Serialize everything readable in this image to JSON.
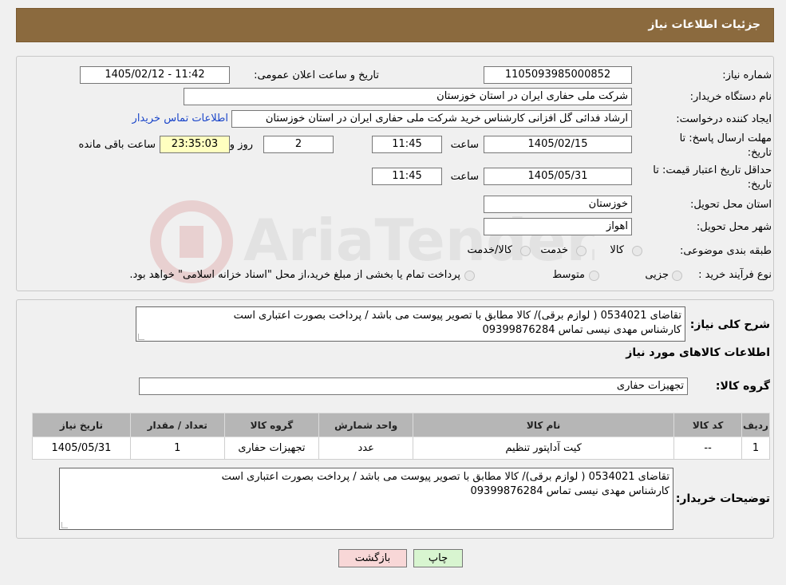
{
  "header": {
    "title": "جزئیات اطلاعات نیاز"
  },
  "form": {
    "need_number_label": "شماره نیاز:",
    "need_number": "1105093985000852",
    "announce_label": "تاریخ و ساعت اعلان عمومی:",
    "announce_value": "1405/02/12 - 11:42",
    "buyer_label": "نام دستگاه خریدار:",
    "buyer_value": "شرکت ملی حفاری ایران در استان خوزستان",
    "creator_label": "ایجاد کننده درخواست:",
    "creator_value": "ارشاد فدائی گل افزانی کارشناس خرید شرکت ملی حفاری ایران در استان خوزستان",
    "contact_link": "اطلاعات تماس خریدار",
    "deadline_label_1": "مهلت ارسال پاسخ: تا",
    "deadline_label_2": "تاریخ:",
    "deadline_date": "1405/02/15",
    "time_label": "ساعت",
    "deadline_time": "11:45",
    "days_value": "2",
    "days_label": "روز و",
    "remaining_value": "23:35:03",
    "remaining_label": "ساعت باقی مانده",
    "validity_label_1": "حداقل تاریخ اعتبار قیمت: تا",
    "validity_label_2": "تاریخ:",
    "validity_date": "1405/05/31",
    "validity_time": "11:45",
    "province_label": "استان محل تحویل:",
    "province_value": "خوزستان",
    "city_label": "شهر محل تحویل:",
    "city_value": "اهواز",
    "category_label": "طبقه بندی موضوعی:",
    "category_options": [
      "کالا",
      "خدمت",
      "کالا/خدمت"
    ],
    "process_label": "نوع فرآیند خرید :",
    "process_options": [
      "جزیی",
      "متوسط"
    ],
    "process_note": "پرداخت تمام یا بخشی از مبلغ خرید،از محل \"اسناد خزانه اسلامی\" خواهد بود."
  },
  "description": {
    "label": "شرح کلی نیاز:",
    "line1": "تقاضای 0534021 ( لوازم برقی)/  کالا مطابق با تصویر پیوست می باشد / پرداخت بصورت اعتباری است",
    "line2": "کارشناس مهدی نیسی تماس 09399876284"
  },
  "goods_info_title": "اطلاعات کالاهای مورد نیاز",
  "goods_group": {
    "label": "گروه کالا:",
    "value": "تجهیزات حفاری"
  },
  "table": {
    "headers": [
      "ردیف",
      "کد کالا",
      "نام کالا",
      "واحد شمارش",
      "گروه کالا",
      "تعداد / مقدار",
      "تاریخ نیاز"
    ],
    "rows": [
      [
        "1",
        "--",
        "کیت آداپتور تنظیم",
        "عدد",
        "تجهیزات حفاری",
        "1",
        "1405/05/31"
      ]
    ]
  },
  "buyer_notes": {
    "label": "توضیحات خریدار:",
    "line1": "تقاضای 0534021 ( لوازم برقی)/  کالا مطابق با تصویر پیوست می باشد / پرداخت بصورت اعتباری است",
    "line2": "کارشناس مهدی نیسی تماس 09399876284"
  },
  "buttons": {
    "print": "چاپ",
    "back": "بازگشت"
  },
  "colors": {
    "header_bg": "#8b6a3e",
    "link": "#1a45c9",
    "back_btn": "#f8d7d7",
    "print_btn": "#d8f5d0",
    "remaining_bg": "#ffffc0"
  }
}
